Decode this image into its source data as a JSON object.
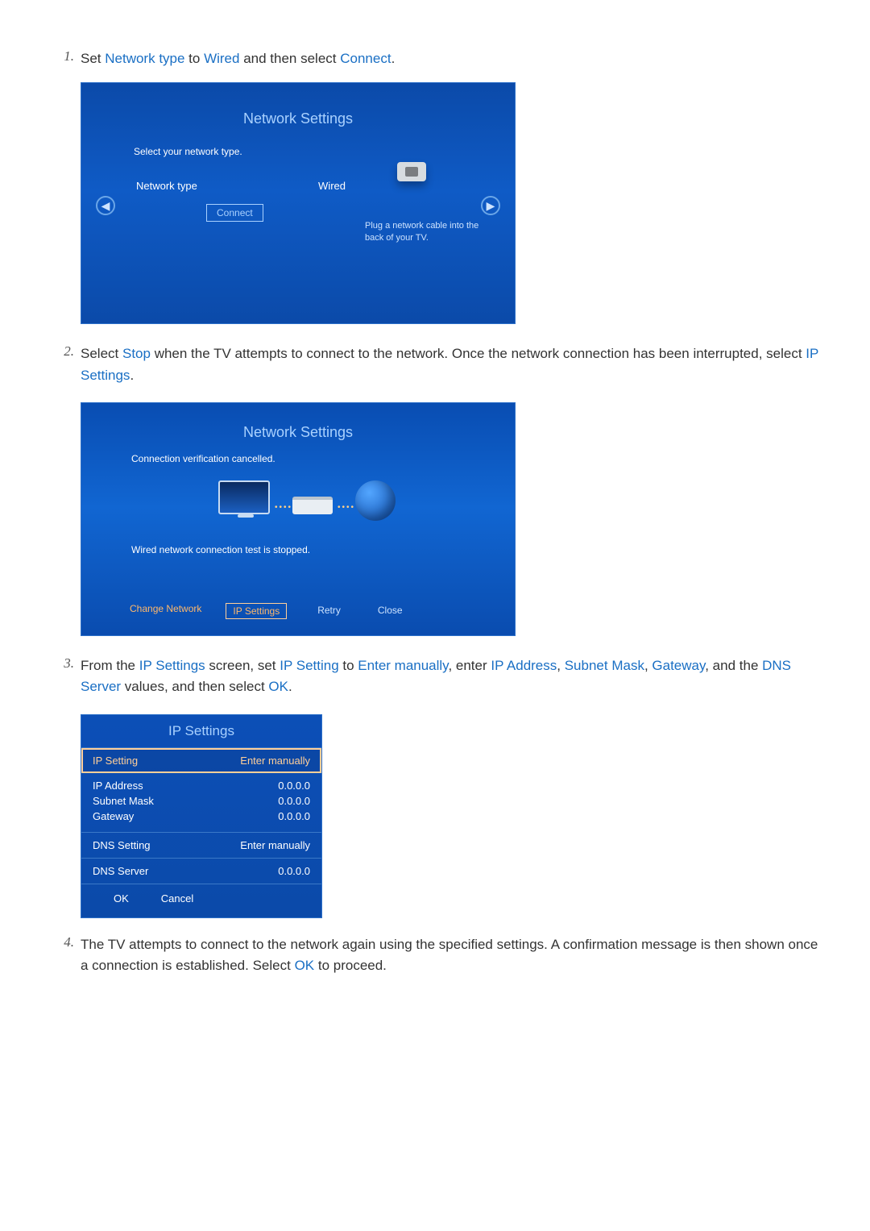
{
  "step1": {
    "num": "1.",
    "pre": "Set ",
    "h1": "Network type",
    "mid1": " to ",
    "h2": "Wired",
    "mid2": " and then select ",
    "h3": "Connect",
    "post": "."
  },
  "panelA": {
    "title": "Network Settings",
    "subtitle": "Select your network type.",
    "label": "Network type",
    "value": "Wired",
    "connect": "Connect",
    "hint": "Plug a network cable into the back of your TV."
  },
  "step2": {
    "num": "2.",
    "pre": "Select ",
    "h1": "Stop",
    "mid1": " when the TV attempts to connect to the network. Once the network connection has been interrupted, select ",
    "h2": "IP Settings",
    "post": "."
  },
  "panelB": {
    "title": "Network Settings",
    "msg1": "Connection verification cancelled.",
    "msg2": "Wired network connection test is stopped.",
    "btnChange": "Change Network",
    "btnIP": "IP Settings",
    "btnRetry": "Retry",
    "btnClose": "Close"
  },
  "step3": {
    "num": "3.",
    "pre": "From the ",
    "h1": "IP Settings",
    "mid1": " screen, set ",
    "h2": "IP Setting",
    "mid2": " to ",
    "h3": "Enter manually",
    "mid3": ", enter ",
    "h4": "IP Address",
    "mid4": ", ",
    "h5": "Subnet Mask",
    "mid5": ", ",
    "h6": "Gateway",
    "mid6": ", and the ",
    "h7": "DNS Server",
    "mid7": " values, and then select ",
    "h8": "OK",
    "post": "."
  },
  "panelC": {
    "title": "IP Settings",
    "ipSettingLab": "IP Setting",
    "ipSettingVal": "Enter manually",
    "ipAddrLab": "IP Address",
    "ipAddrVal": "0.0.0.0",
    "subnetLab": "Subnet Mask",
    "subnetVal": "0.0.0.0",
    "gatewayLab": "Gateway",
    "gatewayVal": "0.0.0.0",
    "dnsSettingLab": "DNS Setting",
    "dnsSettingVal": "Enter manually",
    "dnsServerLab": "DNS Server",
    "dnsServerVal": "0.0.0.0",
    "ok": "OK",
    "cancel": "Cancel"
  },
  "step4": {
    "num": "4.",
    "pre": "The TV attempts to connect to the network again using the specified settings. A confirmation message is then shown once a connection is established. Select ",
    "h1": "OK",
    "post": " to proceed."
  }
}
